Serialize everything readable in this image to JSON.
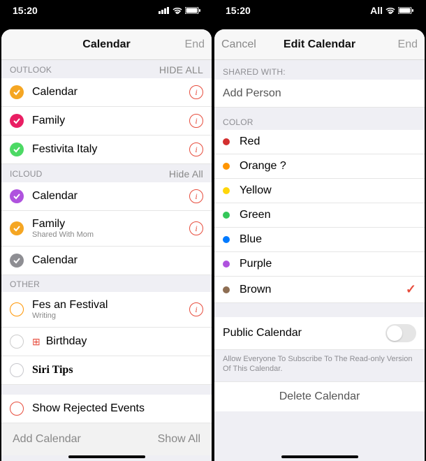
{
  "status": {
    "time": "15:20",
    "right": "All"
  },
  "left": {
    "nav": {
      "title": "Calendar",
      "right": "End"
    },
    "sections": [
      {
        "label": "OUTLOOK",
        "hide": "HIDE ALL",
        "items": [
          {
            "name": "Calendar",
            "color": "#f5a623",
            "checked": true,
            "info": true
          },
          {
            "name": "Family",
            "color": "#e91e63",
            "checked": true,
            "info": true
          },
          {
            "name": "Festivita Italy",
            "color": "#4cd964",
            "checked": true,
            "info": true
          }
        ]
      },
      {
        "label": "ICLOUD",
        "hide": "Hide All",
        "items": [
          {
            "name": "Calendar",
            "color": "#af52de",
            "checked": true,
            "info": true
          },
          {
            "name": "Family",
            "sub": "Shared With Mom",
            "color": "#f5a623",
            "checked": true,
            "info": true
          },
          {
            "name": "Calendar",
            "color": "#8e8e93",
            "checked": true,
            "info": false
          }
        ]
      },
      {
        "label": "OTHER",
        "hide": "",
        "items": [
          {
            "name": "Fes an Festival",
            "sub": "Writing",
            "color": "#ff9500",
            "checked": false,
            "info": true
          },
          {
            "name": "Birthday",
            "glyph": true,
            "checked": false,
            "info": false
          },
          {
            "name": "Siri Tips",
            "checked": false,
            "info": false,
            "bold": true
          }
        ]
      }
    ],
    "rejected": "Show Rejected Events",
    "footer": {
      "add": "Add Calendar",
      "show": "Show All"
    }
  },
  "right": {
    "nav": {
      "left": "Cancel",
      "title": "Edit Calendar",
      "right": "End"
    },
    "shared_label": "SHARED WITH:",
    "add_person": "Add Person",
    "color_label": "COLOR",
    "colors": [
      {
        "name": "Red",
        "hex": "#d32f2f",
        "selected": false
      },
      {
        "name": "Orange ?",
        "hex": "#ff9500",
        "selected": false
      },
      {
        "name": "Yellow",
        "hex": "#ffd60a",
        "selected": false
      },
      {
        "name": "Green",
        "hex": "#34c759",
        "selected": false
      },
      {
        "name": "Blue",
        "hex": "#007aff",
        "selected": false
      },
      {
        "name": "Purple",
        "hex": "#af52de",
        "selected": false
      },
      {
        "name": "Brown",
        "hex": "#8e6e53",
        "selected": true
      }
    ],
    "public_label": "Public Calendar",
    "public_hint": "Allow Everyone To Subscribe To The Read-only Version Of This Calendar.",
    "delete": "Delete Calendar"
  }
}
